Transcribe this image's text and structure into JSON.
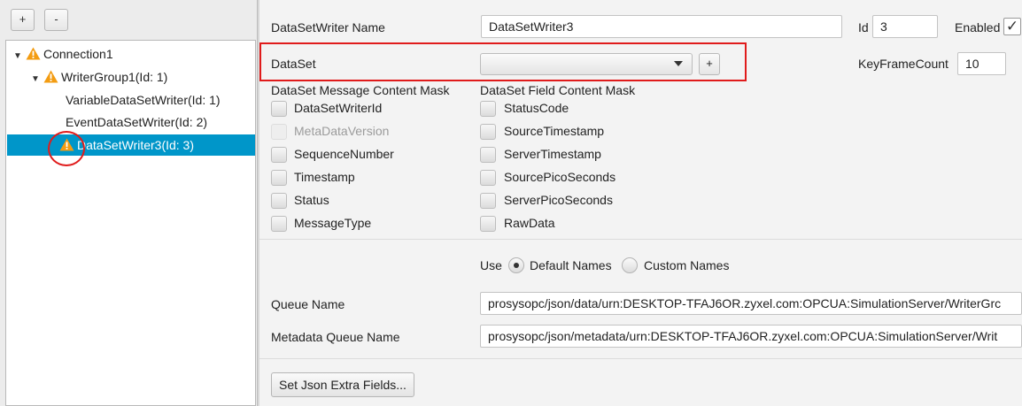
{
  "toolbar": {
    "add_label": "+",
    "remove_label": "-"
  },
  "tree": {
    "connection": "Connection1",
    "writer_group": "WriterGroup1(Id: 1)",
    "variable_writer": "VariableDataSetWriter(Id: 1)",
    "event_writer": "EventDataSetWriter(Id: 2)",
    "selected_writer": "DataSetWriter3(Id: 3)"
  },
  "form": {
    "name_label": "DataSetWriter Name",
    "name_value": "DataSetWriter3",
    "id_label": "Id",
    "id_value": "3",
    "enabled_label": "Enabled",
    "enabled_check": "✓",
    "dataset_label": "DataSet",
    "dataset_add": "+",
    "keyframe_label": "KeyFrameCount",
    "keyframe_value": "10",
    "message_mask_label": "DataSet Message Content Mask",
    "field_mask_label": "DataSet Field Content Mask",
    "message_mask": [
      "DataSetWriterId",
      "MetaDataVersion",
      "SequenceNumber",
      "Timestamp",
      "Status",
      "MessageType"
    ],
    "field_mask": [
      "StatusCode",
      "SourceTimestamp",
      "ServerTimestamp",
      "SourcePicoSeconds",
      "ServerPicoSeconds",
      "RawData"
    ],
    "use_label": "Use",
    "default_names": "Default Names",
    "custom_names": "Custom Names",
    "queue_label": "Queue Name",
    "queue_value": "prosysopc/json/data/urn:DESKTOP-TFAJ6OR.zyxel.com:OPCUA:SimulationServer/WriterGrc",
    "meta_queue_label": "Metadata Queue Name",
    "meta_queue_value": "prosysopc/json/metadata/urn:DESKTOP-TFAJ6OR.zyxel.com:OPCUA:SimulationServer/Writ",
    "extra_button": "Set Json Extra Fields..."
  },
  "colors": {
    "selection": "#0096c9",
    "highlight": "#e01b1b",
    "warning": "#f39c12"
  }
}
